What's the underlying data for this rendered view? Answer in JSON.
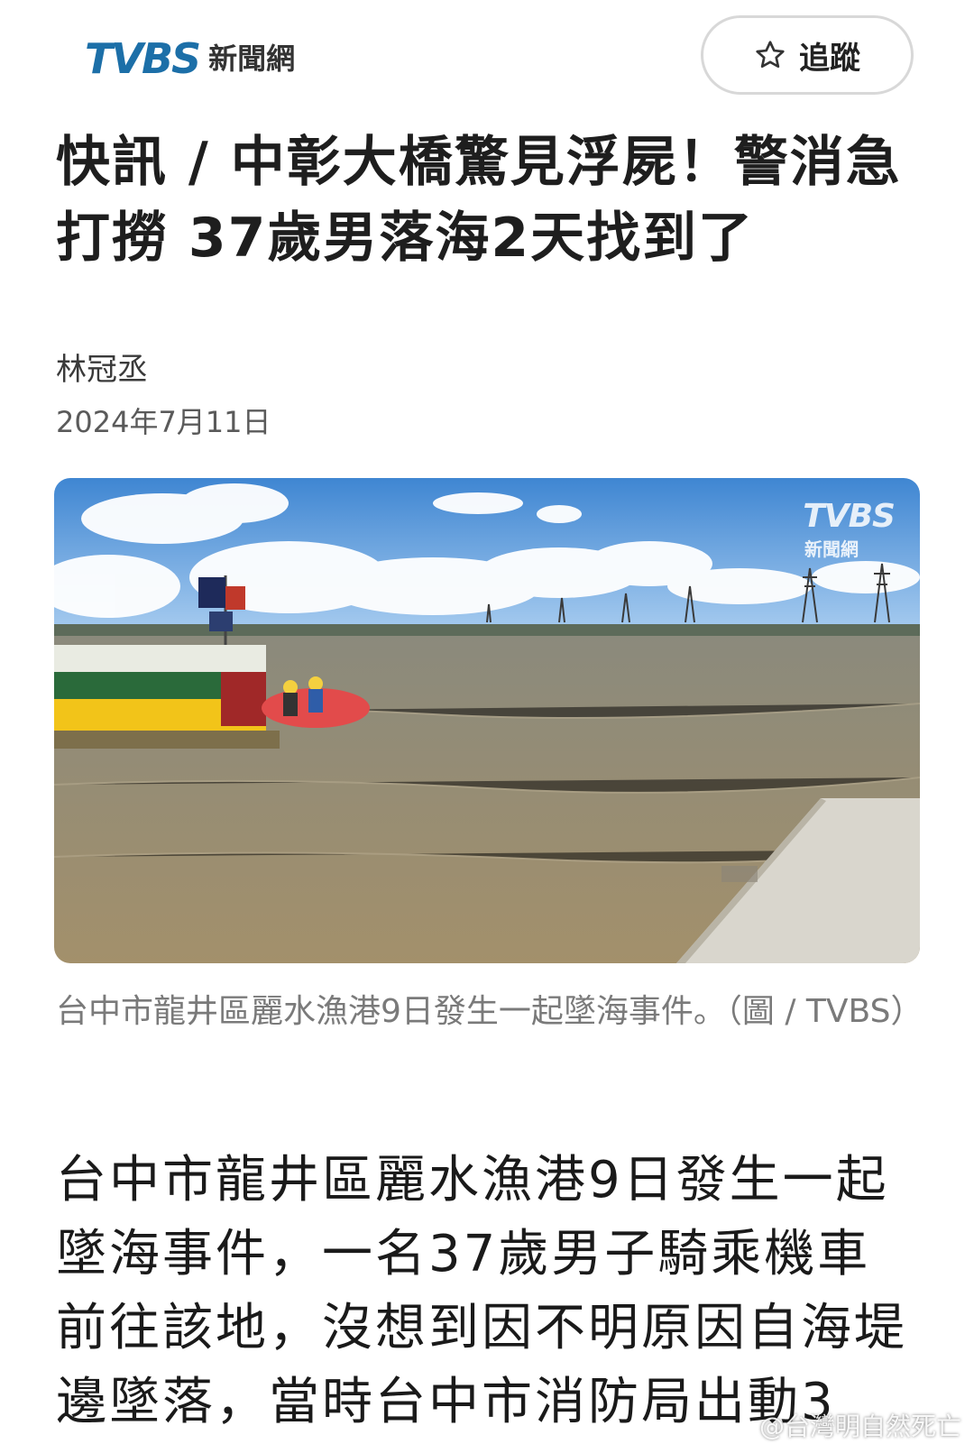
{
  "header": {
    "logo_mark": "TVBS",
    "logo_sub": "新聞網",
    "follow_label": "追蹤"
  },
  "article": {
    "title": "快訊 / 中彰大橋驚見浮屍！警消急打撈 37歲男落海2天找到了",
    "author": "林冠丞",
    "date": "2024年7月11日",
    "photo_watermark_mark": "TVBS",
    "photo_watermark_sub": "新聞網",
    "caption": "台中市龍井區麗水漁港9日發生一起墜海事件。（圖 / TVBS）",
    "body": "台中市龍井區麗水漁港9日發生一起墜海事件，一名37歲男子騎乘機車前往該地，沒想到因不明原因自海堤邊墜落，當時台中市消防局出動3"
  },
  "overlay": {
    "weibo_watermark": "@台灣明自然死亡"
  },
  "colors": {
    "brand": "#1c6fa8",
    "caption": "#7a7a7a"
  }
}
